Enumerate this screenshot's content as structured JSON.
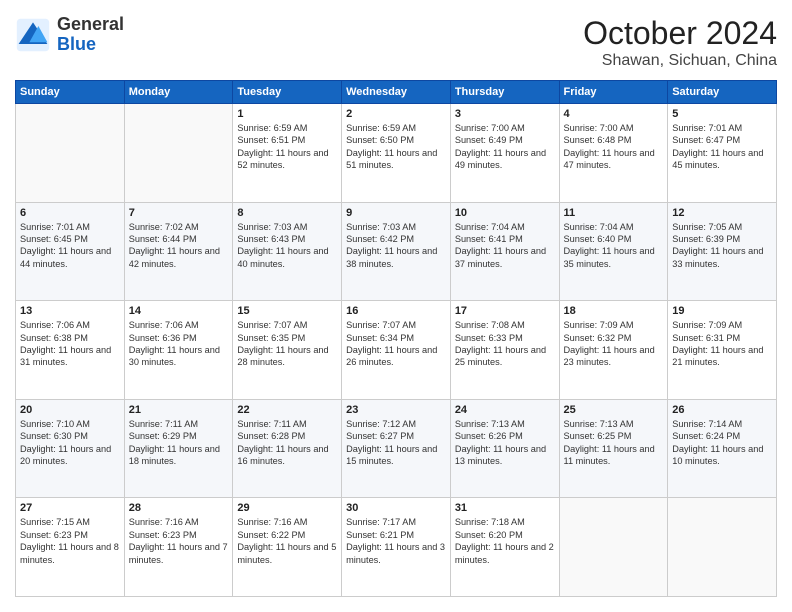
{
  "logo": {
    "general": "General",
    "blue": "Blue"
  },
  "title": "October 2024",
  "location": "Shawan, Sichuan, China",
  "weekdays": [
    "Sunday",
    "Monday",
    "Tuesday",
    "Wednesday",
    "Thursday",
    "Friday",
    "Saturday"
  ],
  "weeks": [
    [
      {
        "day": "",
        "info": ""
      },
      {
        "day": "",
        "info": ""
      },
      {
        "day": "1",
        "info": "Sunrise: 6:59 AM\nSunset: 6:51 PM\nDaylight: 11 hours and 52 minutes."
      },
      {
        "day": "2",
        "info": "Sunrise: 6:59 AM\nSunset: 6:50 PM\nDaylight: 11 hours and 51 minutes."
      },
      {
        "day": "3",
        "info": "Sunrise: 7:00 AM\nSunset: 6:49 PM\nDaylight: 11 hours and 49 minutes."
      },
      {
        "day": "4",
        "info": "Sunrise: 7:00 AM\nSunset: 6:48 PM\nDaylight: 11 hours and 47 minutes."
      },
      {
        "day": "5",
        "info": "Sunrise: 7:01 AM\nSunset: 6:47 PM\nDaylight: 11 hours and 45 minutes."
      }
    ],
    [
      {
        "day": "6",
        "info": "Sunrise: 7:01 AM\nSunset: 6:45 PM\nDaylight: 11 hours and 44 minutes."
      },
      {
        "day": "7",
        "info": "Sunrise: 7:02 AM\nSunset: 6:44 PM\nDaylight: 11 hours and 42 minutes."
      },
      {
        "day": "8",
        "info": "Sunrise: 7:03 AM\nSunset: 6:43 PM\nDaylight: 11 hours and 40 minutes."
      },
      {
        "day": "9",
        "info": "Sunrise: 7:03 AM\nSunset: 6:42 PM\nDaylight: 11 hours and 38 minutes."
      },
      {
        "day": "10",
        "info": "Sunrise: 7:04 AM\nSunset: 6:41 PM\nDaylight: 11 hours and 37 minutes."
      },
      {
        "day": "11",
        "info": "Sunrise: 7:04 AM\nSunset: 6:40 PM\nDaylight: 11 hours and 35 minutes."
      },
      {
        "day": "12",
        "info": "Sunrise: 7:05 AM\nSunset: 6:39 PM\nDaylight: 11 hours and 33 minutes."
      }
    ],
    [
      {
        "day": "13",
        "info": "Sunrise: 7:06 AM\nSunset: 6:38 PM\nDaylight: 11 hours and 31 minutes."
      },
      {
        "day": "14",
        "info": "Sunrise: 7:06 AM\nSunset: 6:36 PM\nDaylight: 11 hours and 30 minutes."
      },
      {
        "day": "15",
        "info": "Sunrise: 7:07 AM\nSunset: 6:35 PM\nDaylight: 11 hours and 28 minutes."
      },
      {
        "day": "16",
        "info": "Sunrise: 7:07 AM\nSunset: 6:34 PM\nDaylight: 11 hours and 26 minutes."
      },
      {
        "day": "17",
        "info": "Sunrise: 7:08 AM\nSunset: 6:33 PM\nDaylight: 11 hours and 25 minutes."
      },
      {
        "day": "18",
        "info": "Sunrise: 7:09 AM\nSunset: 6:32 PM\nDaylight: 11 hours and 23 minutes."
      },
      {
        "day": "19",
        "info": "Sunrise: 7:09 AM\nSunset: 6:31 PM\nDaylight: 11 hours and 21 minutes."
      }
    ],
    [
      {
        "day": "20",
        "info": "Sunrise: 7:10 AM\nSunset: 6:30 PM\nDaylight: 11 hours and 20 minutes."
      },
      {
        "day": "21",
        "info": "Sunrise: 7:11 AM\nSunset: 6:29 PM\nDaylight: 11 hours and 18 minutes."
      },
      {
        "day": "22",
        "info": "Sunrise: 7:11 AM\nSunset: 6:28 PM\nDaylight: 11 hours and 16 minutes."
      },
      {
        "day": "23",
        "info": "Sunrise: 7:12 AM\nSunset: 6:27 PM\nDaylight: 11 hours and 15 minutes."
      },
      {
        "day": "24",
        "info": "Sunrise: 7:13 AM\nSunset: 6:26 PM\nDaylight: 11 hours and 13 minutes."
      },
      {
        "day": "25",
        "info": "Sunrise: 7:13 AM\nSunset: 6:25 PM\nDaylight: 11 hours and 11 minutes."
      },
      {
        "day": "26",
        "info": "Sunrise: 7:14 AM\nSunset: 6:24 PM\nDaylight: 11 hours and 10 minutes."
      }
    ],
    [
      {
        "day": "27",
        "info": "Sunrise: 7:15 AM\nSunset: 6:23 PM\nDaylight: 11 hours and 8 minutes."
      },
      {
        "day": "28",
        "info": "Sunrise: 7:16 AM\nSunset: 6:23 PM\nDaylight: 11 hours and 7 minutes."
      },
      {
        "day": "29",
        "info": "Sunrise: 7:16 AM\nSunset: 6:22 PM\nDaylight: 11 hours and 5 minutes."
      },
      {
        "day": "30",
        "info": "Sunrise: 7:17 AM\nSunset: 6:21 PM\nDaylight: 11 hours and 3 minutes."
      },
      {
        "day": "31",
        "info": "Sunrise: 7:18 AM\nSunset: 6:20 PM\nDaylight: 11 hours and 2 minutes."
      },
      {
        "day": "",
        "info": ""
      },
      {
        "day": "",
        "info": ""
      }
    ]
  ]
}
